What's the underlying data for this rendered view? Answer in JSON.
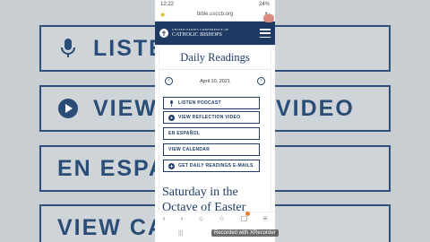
{
  "background": {
    "buttons": [
      "LISTEN PODCAST",
      "VIEW REFLECTION VIDEO",
      "EN ESPAÑOL",
      "VIEW CALENDAR"
    ],
    "visible_fragments": [
      "LISTEN",
      "VIEW R",
      "VIDEO",
      "EN ESPAÑO",
      "VIEW CALE"
    ]
  },
  "status_bar": {
    "time": "12:22",
    "battery": "24%"
  },
  "browser": {
    "url": "bible.usccb.org"
  },
  "site_header": {
    "org_line1": "UNITED STATES CONFERENCE OF",
    "org_line2": "CATHOLIC BISHOPS"
  },
  "page": {
    "title": "Daily Readings",
    "date": "April 10, 2021",
    "buttons": {
      "listen_podcast": "LISTEN PODCAST",
      "view_reflection_video": "VIEW REFLECTION VIDEO",
      "en_espanol": "EN ESPAÑOL",
      "view_calendar": "VIEW CALENDAR",
      "get_emails": "GET DAILY READINGS E-MAILS"
    },
    "heading": "Saturday in the Octave of Easter"
  },
  "nav": {
    "tab_count": "2"
  },
  "recorder_label": "Recorded with XRecorder",
  "colors": {
    "brand_navy": "#1f3d66",
    "header_bg": "#1e3a62"
  }
}
